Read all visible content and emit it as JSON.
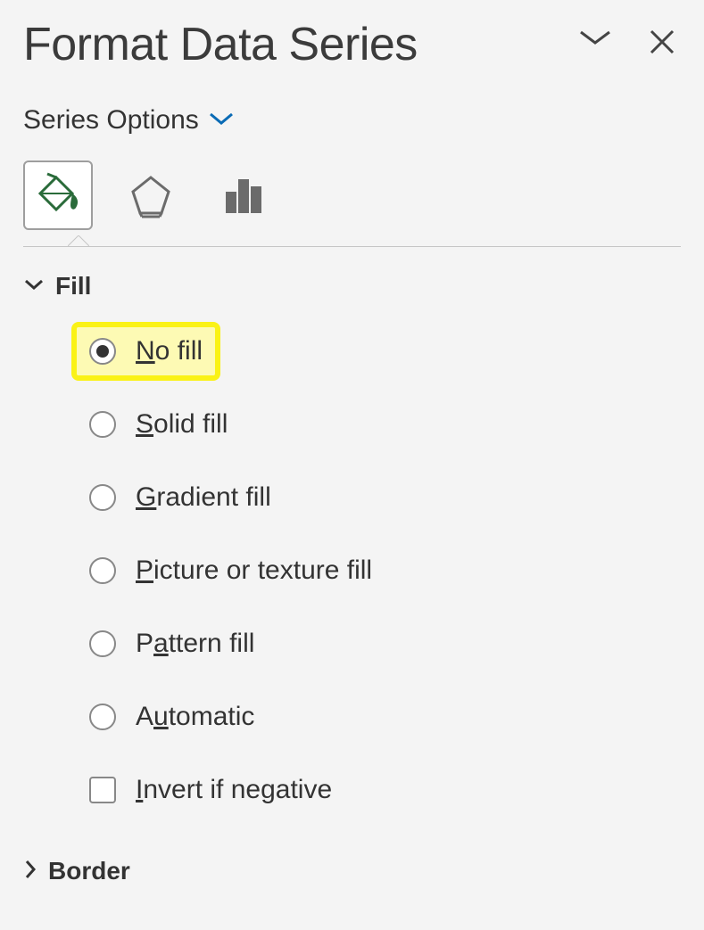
{
  "header": {
    "title": "Format Data Series"
  },
  "series_options_label": "Series Options",
  "tabs": {
    "fill_line": "Fill & Line",
    "effects": "Effects",
    "series_options": "Series Options"
  },
  "sections": {
    "fill": {
      "label": "Fill",
      "options": {
        "no_fill": {
          "pre": "",
          "u": "N",
          "post": "o fill"
        },
        "solid_fill": {
          "pre": "",
          "u": "S",
          "post": "olid fill"
        },
        "gradient_fill": {
          "pre": "",
          "u": "G",
          "post": "radient fill"
        },
        "picture_texture_fill": {
          "pre": "",
          "u": "P",
          "post": "icture or texture fill"
        },
        "pattern_fill": {
          "pre": "P",
          "u": "a",
          "post": "ttern fill"
        },
        "automatic": {
          "pre": "A",
          "u": "u",
          "post": "tomatic"
        },
        "invert_if_negative": {
          "pre": "",
          "u": "I",
          "post": "nvert if negative"
        }
      }
    },
    "border": {
      "label": "Border"
    }
  }
}
